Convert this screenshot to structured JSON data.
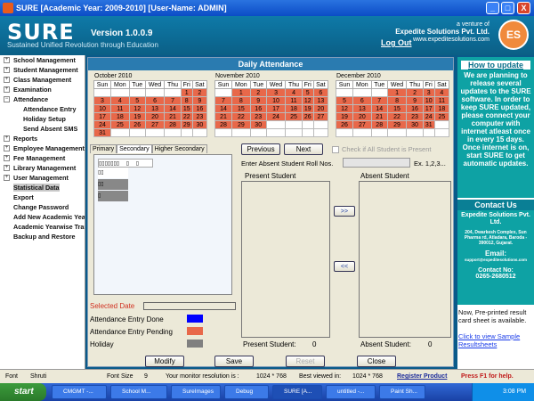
{
  "window": {
    "title": "SURE  [Academic Year: 2009-2010]  [User-Name: ADMIN]",
    "min": "_",
    "max": "□",
    "close": "X"
  },
  "banner": {
    "logo": "SURE",
    "version": "Version 1.0.0.9",
    "tagline": "Sustained Unified Revolution through Education",
    "venture_line": "a venture of",
    "company": "Expedite Solutions Pvt. Ltd.",
    "website": "www.expeditesolutions.com",
    "logout": "Log Out",
    "badge": "ES"
  },
  "menu": [
    {
      "label": "School Management",
      "type": "plus"
    },
    {
      "label": "Student Management",
      "type": "plus"
    },
    {
      "label": "Class Management",
      "type": "plus"
    },
    {
      "label": "Examination",
      "type": "plus"
    },
    {
      "label": "Attendance",
      "type": "minus"
    },
    {
      "label": "Attendance Entry",
      "type": "sub"
    },
    {
      "label": "Holiday Setup",
      "type": "sub"
    },
    {
      "label": "Send Absent SMS",
      "type": "sub"
    },
    {
      "label": "Reports",
      "type": "plus"
    },
    {
      "label": "Employee Management",
      "type": "plus"
    },
    {
      "label": "Fee Management",
      "type": "plus"
    },
    {
      "label": "Library Management",
      "type": "plus"
    },
    {
      "label": "User Management",
      "type": "plus"
    },
    {
      "label": "Statistical Data",
      "type": "top",
      "selected": true
    },
    {
      "label": "Export",
      "type": "top"
    },
    {
      "label": "Change Password",
      "type": "top"
    },
    {
      "label": "Add New Academic Year",
      "type": "top"
    },
    {
      "label": "Academic Yearwise Transfer",
      "type": "top"
    },
    {
      "label": "Backup and Restore",
      "type": "top"
    }
  ],
  "panel": {
    "title": "Daily Attendance"
  },
  "calendars": [
    {
      "title": "October 2010",
      "start": 5,
      "days": 31
    },
    {
      "title": "November 2010",
      "start": 1,
      "days": 30
    },
    {
      "title": "December 2010",
      "start": 3,
      "days": 31
    }
  ],
  "weekdays": [
    "Sun",
    "Mon",
    "Tue",
    "Wed",
    "Thu",
    "Fri",
    "Sat"
  ],
  "tabs": [
    "Primary",
    "Secondary",
    "Higher Secondary"
  ],
  "class_grid": {
    "header": [
      "▯▯▯▯▯▯▯",
      "▯",
      "▯"
    ],
    "rows": [
      [
        "▯▯"
      ],
      [
        "▯▯"
      ],
      [
        "▯"
      ]
    ]
  },
  "buttons": {
    "previous": "Previous",
    "next": "Next",
    "to_absent": ">>",
    "to_present": "<<",
    "modify": "Modify",
    "save": "Save",
    "reset": "Reset",
    "close": "Close"
  },
  "check_all": "Check if All Student is Present",
  "absent_roll": {
    "label": "Enter Absent Student Roll Nos.",
    "value": "",
    "example": "Ex. 1,2,3..."
  },
  "present": {
    "title": "Present Student",
    "count_label": "Present Student:",
    "count": "0"
  },
  "absent": {
    "title": "Absent Student",
    "count_label": "Absent Student:",
    "count": "0"
  },
  "legend": {
    "selected_date": "Selected Date",
    "entry_done": "Attendance Entry Done",
    "entry_pending": "Attendance Entry Pending",
    "holiday": "Holiday",
    "colors": {
      "done": "#0000ff",
      "pending": "#e8684a",
      "holiday": "#808080"
    }
  },
  "side": {
    "update_title": "How to update",
    "update_text": "We are planning to release several updates to the SURE software. In order to keep SURE updated, please connect your computer with internet atleast once in every 15 days. Once internet is on, start SURE to get automatic updates.",
    "contact_title": "Contact Us",
    "contact_company": "Expedite Solutions Pvt. Ltd.",
    "address": "204, Dwarkesh Complex, Sun Pharma rd, Atladara, Baroda - 390012, Gujarat.",
    "email_label": "Email:",
    "email": "support@expeditesolutions.com",
    "contact_no_label": "Contact No:",
    "contact_no": "0265-2680512",
    "promo": "Now, Pre-printed result card sheet is available.",
    "promo_link": "Click to view Sample Resultsheets"
  },
  "status": {
    "font_label": "Font",
    "font": "Shruti",
    "size_label": "Font Size",
    "size": "9",
    "res_label": "Your monitor resolution is :",
    "res": "1024 * 768",
    "best_label": "Best viewed in:",
    "best": "1024 * 768",
    "register": "Register Product",
    "help": "Press F1 for help."
  },
  "taskbar": {
    "start": "start",
    "items": [
      "CMGMT -...",
      "School M...",
      "SureImages",
      "Debug",
      "SURE  [A...",
      "untitled -...",
      "Paint Sh..."
    ],
    "clock": "3:08 PM"
  }
}
